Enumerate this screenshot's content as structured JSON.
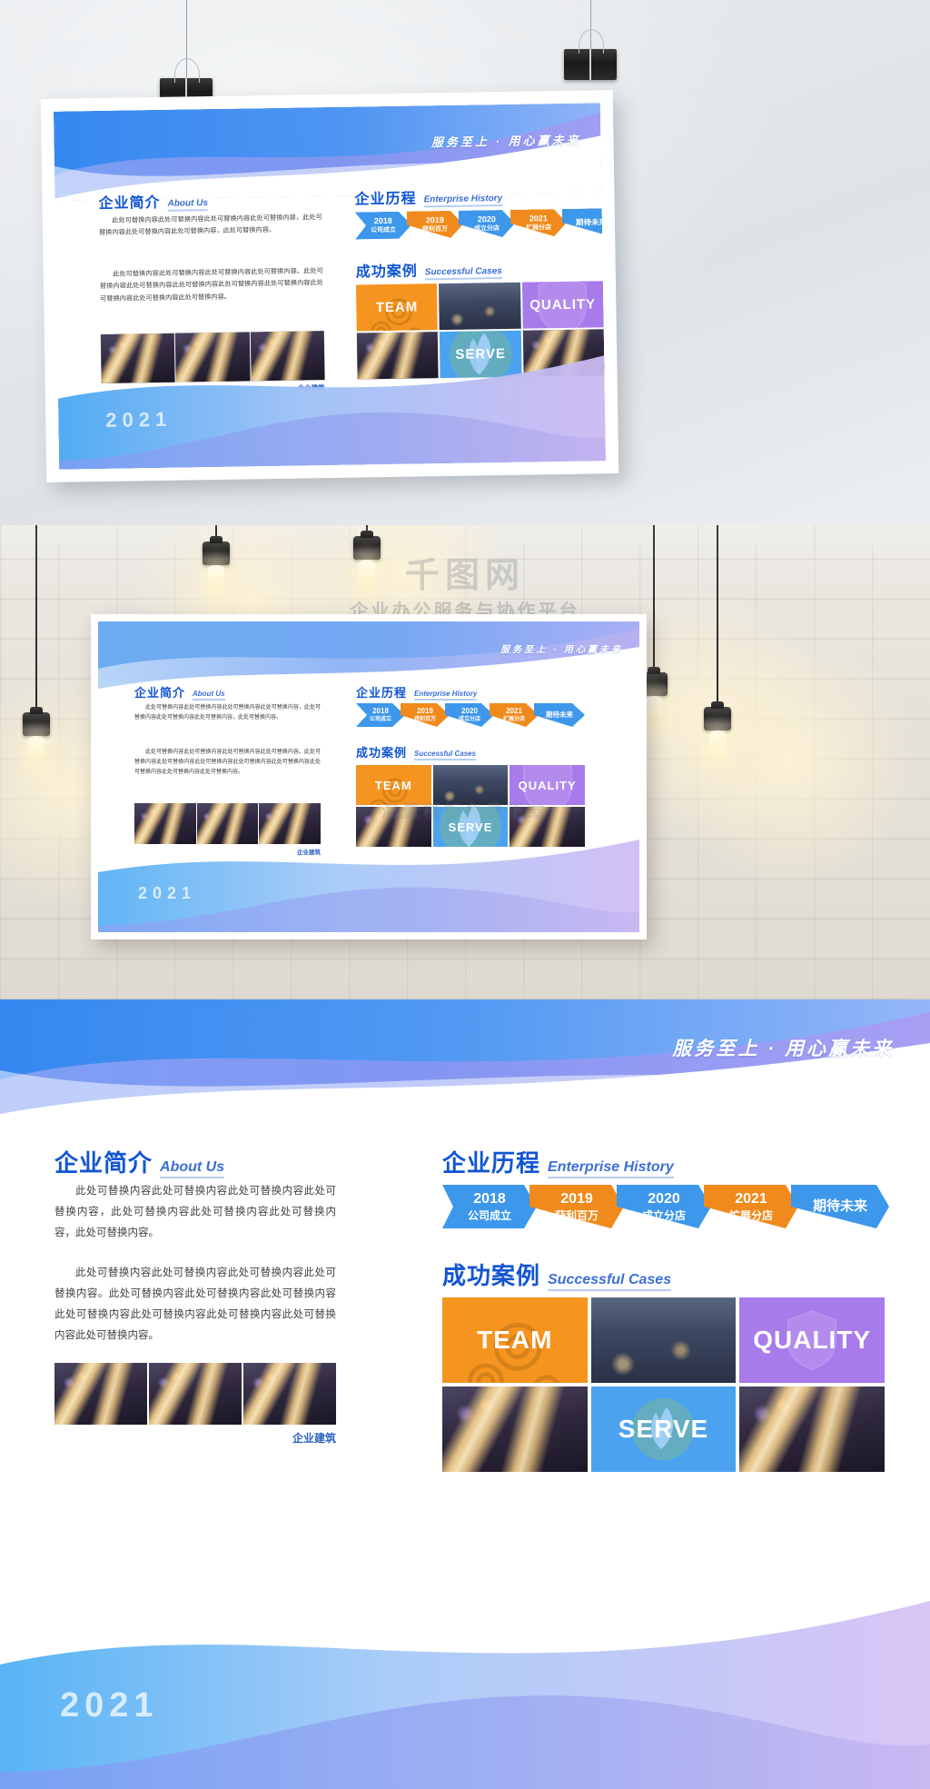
{
  "poster": {
    "slogan": "服务至上 · 用心赢未来",
    "year_mark": "2021",
    "about": {
      "title_cn": "企业简介",
      "title_en": "About Us",
      "paragraph1": "此处可替换内容此处可替换内容此处可替换内容此处可替换内容，此处可替换内容此处可替换内容此处可替换内容，此处可替换内容。",
      "paragraph2": "此处可替换内容此处可替换内容此处可替换内容此处可替换内容。此处可替换内容此处可替换内容此处可替换内容此处可替换内容此处可替换内容此处可替换内容此处可替换内容此处可替换内容。",
      "image_caption": "企业建筑"
    },
    "history": {
      "title_cn": "企业历程",
      "title_en": "Enterprise History",
      "steps": [
        {
          "year": "2018",
          "label": "公司成立",
          "color": "#3d97eb"
        },
        {
          "year": "2019",
          "label": "获利百万",
          "color": "#f18a1c"
        },
        {
          "year": "2020",
          "label": "成立分店",
          "color": "#3d97eb"
        },
        {
          "year": "2021",
          "label": "扩展分店",
          "color": "#f18a1c"
        },
        {
          "year": "",
          "label": "期待未来",
          "color": "#3d97eb"
        }
      ]
    },
    "cases": {
      "title_cn": "成功案例",
      "title_en": "Successful Cases",
      "tiles": [
        {
          "kind": "text",
          "label": "TEAM",
          "bg": "#f5941f",
          "icon": "gears-icon"
        },
        {
          "kind": "photo",
          "label": "",
          "photo": "city-skyline-photo"
        },
        {
          "kind": "text",
          "label": "QUALITY",
          "bg": "#a77bea",
          "icon": "shield-icon"
        },
        {
          "kind": "photo",
          "label": "",
          "photo": "night-highway-photo"
        },
        {
          "kind": "text",
          "label": "SERVE",
          "bg": "#4ba3ef",
          "icon": "leaf-circle-icon"
        },
        {
          "kind": "photo",
          "label": "",
          "photo": "night-highway-photo"
        }
      ]
    }
  },
  "mockup": {
    "wall_watermark_1": "千图网",
    "wall_watermark_2": "企业办公服务与协作平台",
    "wall_watermark_3": "海量模板免费下载"
  },
  "palette": {
    "blue": "#3d97eb",
    "orange": "#f18a1c",
    "title_blue": "#1155d4",
    "purple": "#a77bea",
    "light_blue": "#4ba3ef",
    "wave_blue": "#5b8def",
    "wave_purple": "#b6a8f0"
  }
}
